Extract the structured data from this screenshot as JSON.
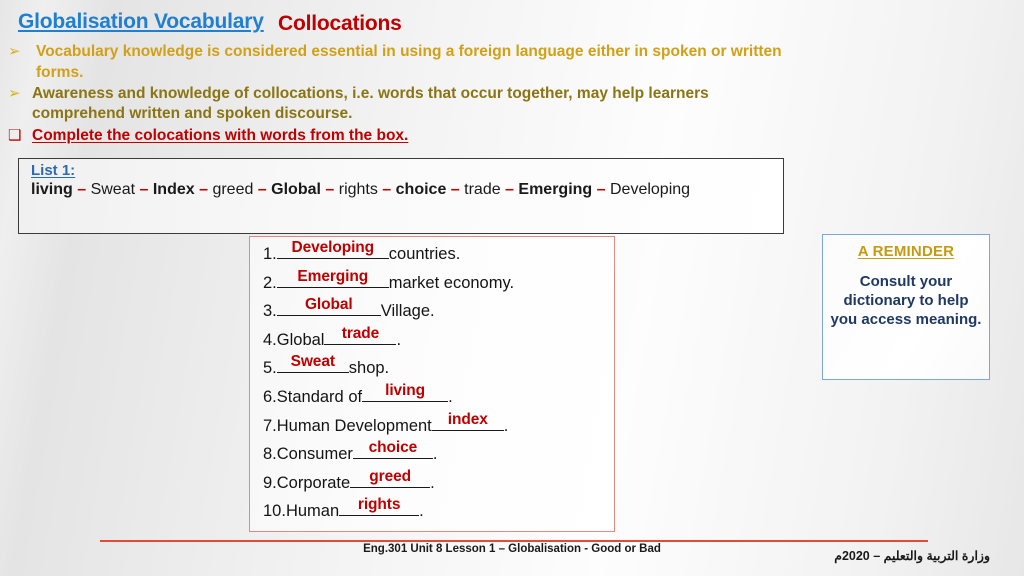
{
  "header": {
    "topic_label": "Globalisation Vocabulary",
    "title": "Collocations"
  },
  "bullets": [
    {
      "marker": "arrow-bullet-icon",
      "glyph": "➢",
      "line1": "Vocabulary knowledge is considered essential in using a foreign language either in spoken or written",
      "line2": "forms."
    },
    {
      "marker": "arrow-bullet-icon",
      "glyph": "➢",
      "line1": "Awareness and knowledge of collocations, i.e. words that occur together, may help learners",
      "line2": "comprehend written and spoken discourse."
    },
    {
      "marker": "square-bullet-icon",
      "glyph": "❑",
      "line1": "Complete the colocations with words from the box.",
      "line2": ""
    }
  ],
  "word_box": {
    "list_label": "List 1:",
    "separator": "–",
    "words": [
      {
        "text": "living",
        "bold": true
      },
      {
        "text": "Sweat",
        "bold": false
      },
      {
        "text": "Index",
        "bold": true
      },
      {
        "text": "greed",
        "bold": false
      },
      {
        "text": "Global",
        "bold": true
      },
      {
        "text": "rights",
        "bold": false
      },
      {
        "text": "choice",
        "bold": true
      },
      {
        "text": "trade",
        "bold": false
      },
      {
        "text": "Emerging",
        "bold": true
      },
      {
        "text": "Developing",
        "bold": false
      }
    ]
  },
  "answers": [
    {
      "number": "1.",
      "before": "",
      "answer": "Developing",
      "after": "countries.",
      "blank_width": 112
    },
    {
      "number": "2.",
      "before": "",
      "answer": "Emerging",
      "after": "market economy.",
      "blank_width": 112
    },
    {
      "number": "3.",
      "before": "",
      "answer": "Global",
      "after": "Village.",
      "blank_width": 104
    },
    {
      "number": "4.",
      "before": "Global",
      "answer": "trade",
      "after": ".",
      "blank_width": 72
    },
    {
      "number": "5.",
      "before": "",
      "answer": "Sweat",
      "after": "shop.",
      "blank_width": 72
    },
    {
      "number": "6.",
      "before": "Standard of",
      "answer": "living",
      "after": ".",
      "blank_width": 86
    },
    {
      "number": "7.",
      "before": "Human Development",
      "answer": "index",
      "after": ".",
      "blank_width": 72
    },
    {
      "number": "8.",
      "before": "Consumer",
      "answer": "choice",
      "after": ".",
      "blank_width": 80
    },
    {
      "number": "9.",
      "before": "Corporate",
      "answer": "greed",
      "after": ".",
      "blank_width": 80
    },
    {
      "number": "10.",
      "before": "Human",
      "answer": "rights",
      "after": ".",
      "blank_width": 80
    }
  ],
  "reminder": {
    "title": "A REMINDER",
    "body": "Consult your dictionary to help you access meaning."
  },
  "footer": {
    "english": "Eng.301 Unit 8 Lesson 1 – Globalisation - Good or Bad",
    "arabic": "وزارة التربية والتعليم – 2020م"
  },
  "colors": {
    "topic_blue": "#1f7fd0",
    "title_red": "#c00000",
    "bullet_gold": "#d2a017",
    "bullet_olive": "#8a7512",
    "answer_red": "#c00000",
    "reminder_gold": "#c79a14",
    "reminder_navy": "#1f3864",
    "reminder_border": "#7ba7d7",
    "answers_border": "#e08a80",
    "footer_rule": "#e24b3a"
  }
}
